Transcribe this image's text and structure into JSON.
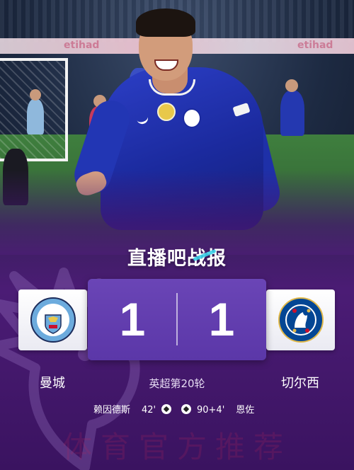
{
  "brand": {
    "title": "直播吧战报"
  },
  "match": {
    "competition_round": "英超第20轮",
    "home": {
      "name": "曼城",
      "score": "1",
      "crest_text": "MANCHESTER CITY",
      "scorer": "赖因德斯",
      "minute": "42'",
      "color": "#6cabdd"
    },
    "away": {
      "name": "切尔西",
      "score": "1",
      "crest_text": "CHELSEA FOOTBALL CLUB",
      "scorer": "恩佐",
      "minute": "90+4'",
      "color": "#034694"
    }
  },
  "photo": {
    "ad_text": "etihad"
  },
  "watermark": "体育官方推荐",
  "icons": {
    "goal": "football-icon",
    "watermark": "premier-league-lion-icon"
  },
  "colors": {
    "accent": "#5b37a8",
    "background": "#4b1c75",
    "brand_slash": "#3ad1e8"
  }
}
